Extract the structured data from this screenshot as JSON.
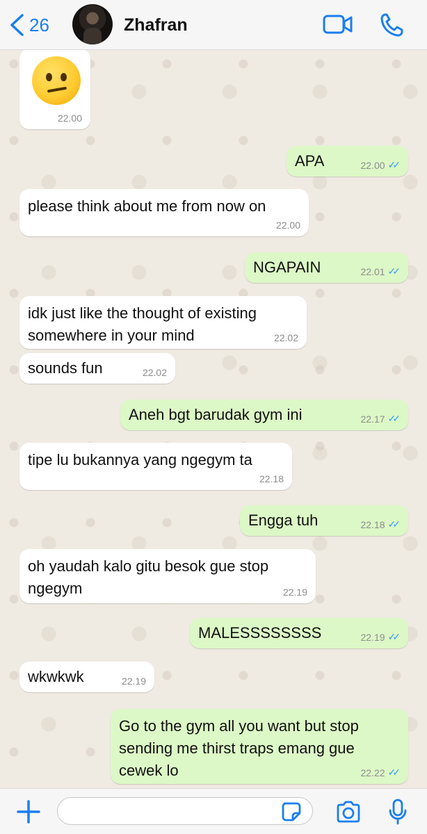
{
  "header": {
    "back_count": "26",
    "contact_name": "Zhafran"
  },
  "messages": [
    {
      "dir": "in",
      "emoji": "confused-face-emoji",
      "time": "22.00"
    },
    {
      "dir": "out",
      "text": "APA",
      "time": "22.00",
      "read": true
    },
    {
      "dir": "in",
      "text": "please think about me from now on",
      "time": "22.00"
    },
    {
      "dir": "out",
      "text": "NGAPAIN",
      "time": "22.01",
      "read": true
    },
    {
      "dir": "in",
      "text": "idk just like the thought of existing somewhere in your mind",
      "time": "22.02"
    },
    {
      "dir": "in",
      "text": "sounds fun",
      "time": "22.02"
    },
    {
      "dir": "out",
      "text": "Aneh bgt barudak gym ini",
      "time": "22.17",
      "read": true
    },
    {
      "dir": "in",
      "text": "tipe lu bukannya yang ngegym ta",
      "time": "22.18"
    },
    {
      "dir": "out",
      "text": "Engga tuh",
      "time": "22.18",
      "read": true
    },
    {
      "dir": "in",
      "text": "oh yaudah kalo gitu besok gue stop ngegym",
      "time": "22.19"
    },
    {
      "dir": "out",
      "text": "MALESSSSSSSS",
      "time": "22.19",
      "read": true
    },
    {
      "dir": "in",
      "text": "wkwkwk",
      "time": "22.19"
    },
    {
      "dir": "out",
      "text": "Go to the gym all you want but stop sending me thirst traps emang gue cewek lo",
      "time": "22.22",
      "read": true
    }
  ],
  "colors": {
    "accent": "#1a7ef0",
    "outgoing_bubble": "#dcf8c6",
    "incoming_bubble": "#ffffff",
    "chat_background": "#efeae2",
    "read_ticks": "#3a9ff2"
  },
  "icons": {
    "back": "chevron-left-icon",
    "video": "video-camera-icon",
    "phone": "phone-icon",
    "plus": "plus-icon",
    "sticker": "sticker-icon",
    "camera": "camera-icon",
    "mic": "microphone-icon"
  },
  "input": {
    "value": "",
    "placeholder": ""
  }
}
